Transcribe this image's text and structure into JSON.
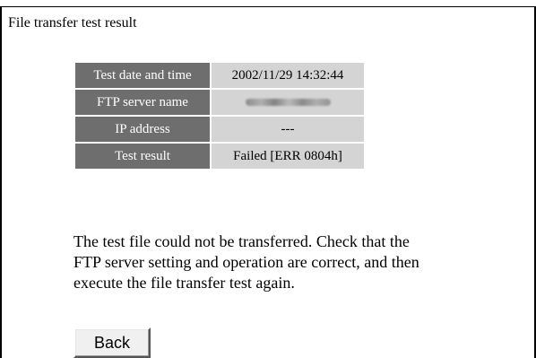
{
  "panel": {
    "title": "File transfer test result"
  },
  "result_table": {
    "rows": [
      {
        "label": "Test date and time",
        "value": "2002/11/29 14:32:44"
      },
      {
        "label": "FTP server name",
        "value": ""
      },
      {
        "label": "IP address",
        "value": "---"
      },
      {
        "label": "Test result",
        "value": "Failed [ERR 0804h]"
      }
    ]
  },
  "message": {
    "lines": [
      "The test file could not be transferred. Check that the",
      "FTP server setting and operation are correct, and then",
      "execute the file transfer test again."
    ]
  },
  "actions": {
    "back_label": "Back"
  }
}
